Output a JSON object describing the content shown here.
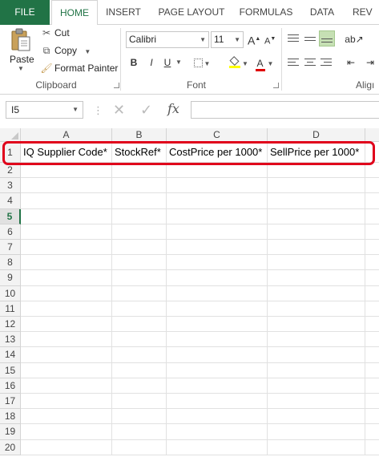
{
  "ribbon_tabs": [
    "FILE",
    "HOME",
    "INSERT",
    "PAGE LAYOUT",
    "FORMULAS",
    "DATA",
    "REV"
  ],
  "active_tab": "HOME",
  "clipboard": {
    "paste_label": "Paste",
    "cut_label": "Cut",
    "copy_label": "Copy",
    "format_painter_label": "Format Painter",
    "group_label": "Clipboard"
  },
  "font": {
    "name": "Calibri",
    "size": "11",
    "group_label": "Font",
    "bold": "B",
    "italic": "I",
    "underline": "U",
    "grow": "A",
    "shrink": "A",
    "font_color_letter": "A",
    "fill_color": "#ffff00",
    "text_color": "#e00000"
  },
  "alignment": {
    "group_label": "Aligı"
  },
  "formula_bar": {
    "name_box": "I5",
    "fx": "fx",
    "formula": ""
  },
  "columns": [
    "A",
    "B",
    "C",
    "D"
  ],
  "rows": [
    "1",
    "2",
    "3",
    "4",
    "5",
    "6",
    "7",
    "8",
    "9",
    "10",
    "11",
    "12",
    "13",
    "14",
    "15",
    "16",
    "17",
    "18",
    "19",
    "20"
  ],
  "active_row": "5",
  "header_cells": [
    "IQ Supplier Code*",
    "StockRef*",
    "CostPrice per 1000*",
    "SellPrice per 1000*"
  ],
  "colors": {
    "excel_green": "#217346",
    "highlight_red": "#e0001b"
  }
}
